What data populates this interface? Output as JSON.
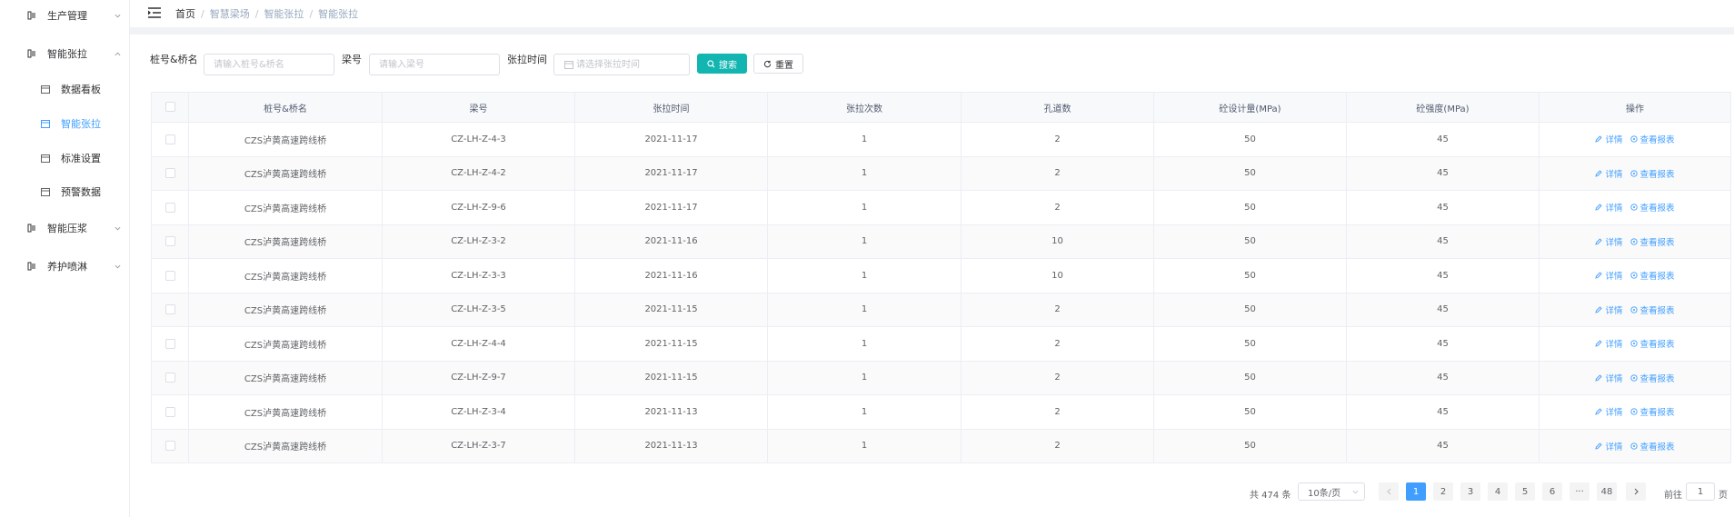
{
  "sidebar": {
    "items": [
      {
        "label": "生产管理",
        "icon": "menu-icon",
        "arrow": "chevron-down-icon"
      },
      {
        "label": "智能张拉",
        "icon": "menu-icon",
        "arrow": "chevron-up-icon"
      },
      {
        "label": "数据看板",
        "icon": "calendar-icon"
      },
      {
        "label": "智能张拉",
        "icon": "calendar-icon"
      },
      {
        "label": "标准设置",
        "icon": "calendar-icon"
      },
      {
        "label": "预警数据",
        "icon": "calendar-icon"
      },
      {
        "label": "智能压浆",
        "icon": "menu-icon",
        "arrow": "chevron-down-icon"
      },
      {
        "label": "养护喷淋",
        "icon": "menu-icon",
        "arrow": "chevron-down-icon"
      }
    ],
    "active_color": "#409eff"
  },
  "breadcrumb": [
    "首页",
    "智慧梁场",
    "智能张拉",
    "智能张拉"
  ],
  "filters": {
    "pile_label": "桩号&桥名",
    "pile_placeholder": "请输入桩号&桥名",
    "beam_label": "梁号",
    "beam_placeholder": "请输入梁号",
    "time_label": "张拉时间",
    "time_placeholder": "请选择张拉时间",
    "search_label": "搜索",
    "reset_label": "重置"
  },
  "table": {
    "headers": [
      "桩号&桥名",
      "梁号",
      "张拉时间",
      "张拉次数",
      "孔道数",
      "砼设计量(MPa)",
      "砼强度(MPa)",
      "操作"
    ],
    "rows": [
      {
        "bridge": "CZS泸黄高速跨线桥",
        "beam": "CZ-LH-Z-4-3",
        "time": "2021-11-17",
        "count": "1",
        "holes": "2",
        "design": "50",
        "strength": "45"
      },
      {
        "bridge": "CZS泸黄高速跨线桥",
        "beam": "CZ-LH-Z-4-2",
        "time": "2021-11-17",
        "count": "1",
        "holes": "2",
        "design": "50",
        "strength": "45"
      },
      {
        "bridge": "CZS泸黄高速跨线桥",
        "beam": "CZ-LH-Z-9-6",
        "time": "2021-11-17",
        "count": "1",
        "holes": "2",
        "design": "50",
        "strength": "45"
      },
      {
        "bridge": "CZS泸黄高速跨线桥",
        "beam": "CZ-LH-Z-3-2",
        "time": "2021-11-16",
        "count": "1",
        "holes": "10",
        "design": "50",
        "strength": "45"
      },
      {
        "bridge": "CZS泸黄高速跨线桥",
        "beam": "CZ-LH-Z-3-3",
        "time": "2021-11-16",
        "count": "1",
        "holes": "10",
        "design": "50",
        "strength": "45"
      },
      {
        "bridge": "CZS泸黄高速跨线桥",
        "beam": "CZ-LH-Z-3-5",
        "time": "2021-11-15",
        "count": "1",
        "holes": "2",
        "design": "50",
        "strength": "45"
      },
      {
        "bridge": "CZS泸黄高速跨线桥",
        "beam": "CZ-LH-Z-4-4",
        "time": "2021-11-15",
        "count": "1",
        "holes": "2",
        "design": "50",
        "strength": "45"
      },
      {
        "bridge": "CZS泸黄高速跨线桥",
        "beam": "CZ-LH-Z-9-7",
        "time": "2021-11-15",
        "count": "1",
        "holes": "2",
        "design": "50",
        "strength": "45"
      },
      {
        "bridge": "CZS泸黄高速跨线桥",
        "beam": "CZ-LH-Z-3-4",
        "time": "2021-11-13",
        "count": "1",
        "holes": "2",
        "design": "50",
        "strength": "45"
      },
      {
        "bridge": "CZS泸黄高速跨线桥",
        "beam": "CZ-LH-Z-3-7",
        "time": "2021-11-13",
        "count": "1",
        "holes": "2",
        "design": "50",
        "strength": "45"
      }
    ],
    "action_detail": "详情",
    "action_report": "查看报表"
  },
  "pagination": {
    "total_text": "共 474 条",
    "page_size": "10条/页",
    "pages": [
      "1",
      "2",
      "3",
      "4",
      "5",
      "6",
      "···",
      "48"
    ],
    "current": "1",
    "goto_label": "前往",
    "goto_value": "1",
    "page_suffix": "页"
  },
  "colors": {
    "accent": "#409eff",
    "search_button": "#13b5b1"
  }
}
